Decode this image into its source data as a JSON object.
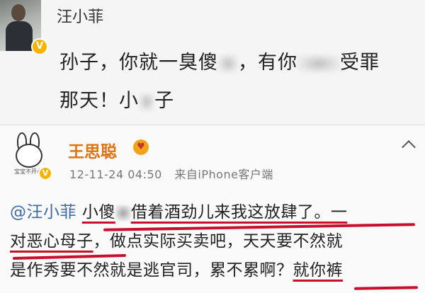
{
  "original_post": {
    "author": "汪小菲",
    "text_line1_a": "孙子，你就一臭傻",
    "text_line1_b": "，有你",
    "text_line1_c": "受罪",
    "text_line2_a": "那天！",
    "text_line2_b": "小",
    "text_line2_c": "子",
    "badge": "V"
  },
  "reply": {
    "author": "王思聪",
    "timestamp": "12-11-24 04:50",
    "source": "来自iPhone客户端",
    "avatar_caption": "宝宝不开心",
    "mention": "@汪小菲",
    "line1_a": "小傻",
    "line1_b": "借着酒劲儿来我这放肆了。一",
    "line2_a": "对恶心母子",
    "line2_b": "，做点实际买卖吧，天天要不然就",
    "line3_a": "是作秀要不然就是逃官司，累不累啊？",
    "line3_b": "就你裤",
    "badge": "V",
    "accent_color": "#e0740d",
    "underline_color": "#c8102e"
  }
}
